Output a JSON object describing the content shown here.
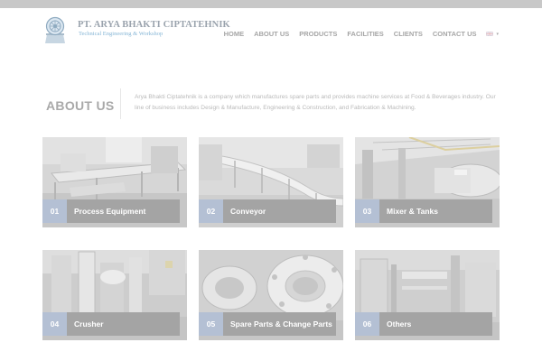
{
  "header": {
    "company_name": "PT. ARYA BHAKTI CIPTATEHNIK",
    "tagline": "Technical Engineering & Workshop"
  },
  "nav": {
    "items": [
      "HOME",
      "ABOUT US",
      "PRODUCTS",
      "FACILITIES",
      "CLIENTS",
      "CONTACT US"
    ],
    "language_icon": "uk-flag-icon"
  },
  "about": {
    "title": "ABOUT US",
    "text": "Arya Bhakti Ciptatehnik is a company which manufactures spare parts and provides machine services at Food & Beverages industry. Our line of business includes Design & Manufacture, Engineering & Construction, and Fabrication & Machining."
  },
  "cards": [
    {
      "number": "01",
      "title": "Process Equipment"
    },
    {
      "number": "02",
      "title": "Conveyor"
    },
    {
      "number": "03",
      "title": "Mixer & Tanks"
    },
    {
      "number": "04",
      "title": "Crusher"
    },
    {
      "number": "05",
      "title": "Spare Parts & Change Parts"
    },
    {
      "number": "06",
      "title": "Others"
    }
  ],
  "colors": {
    "label_bg": "#a4a4a4",
    "number_bg": "#b4c0d4",
    "nav_text": "#a6a6a6",
    "tagline": "#86b6d6"
  }
}
